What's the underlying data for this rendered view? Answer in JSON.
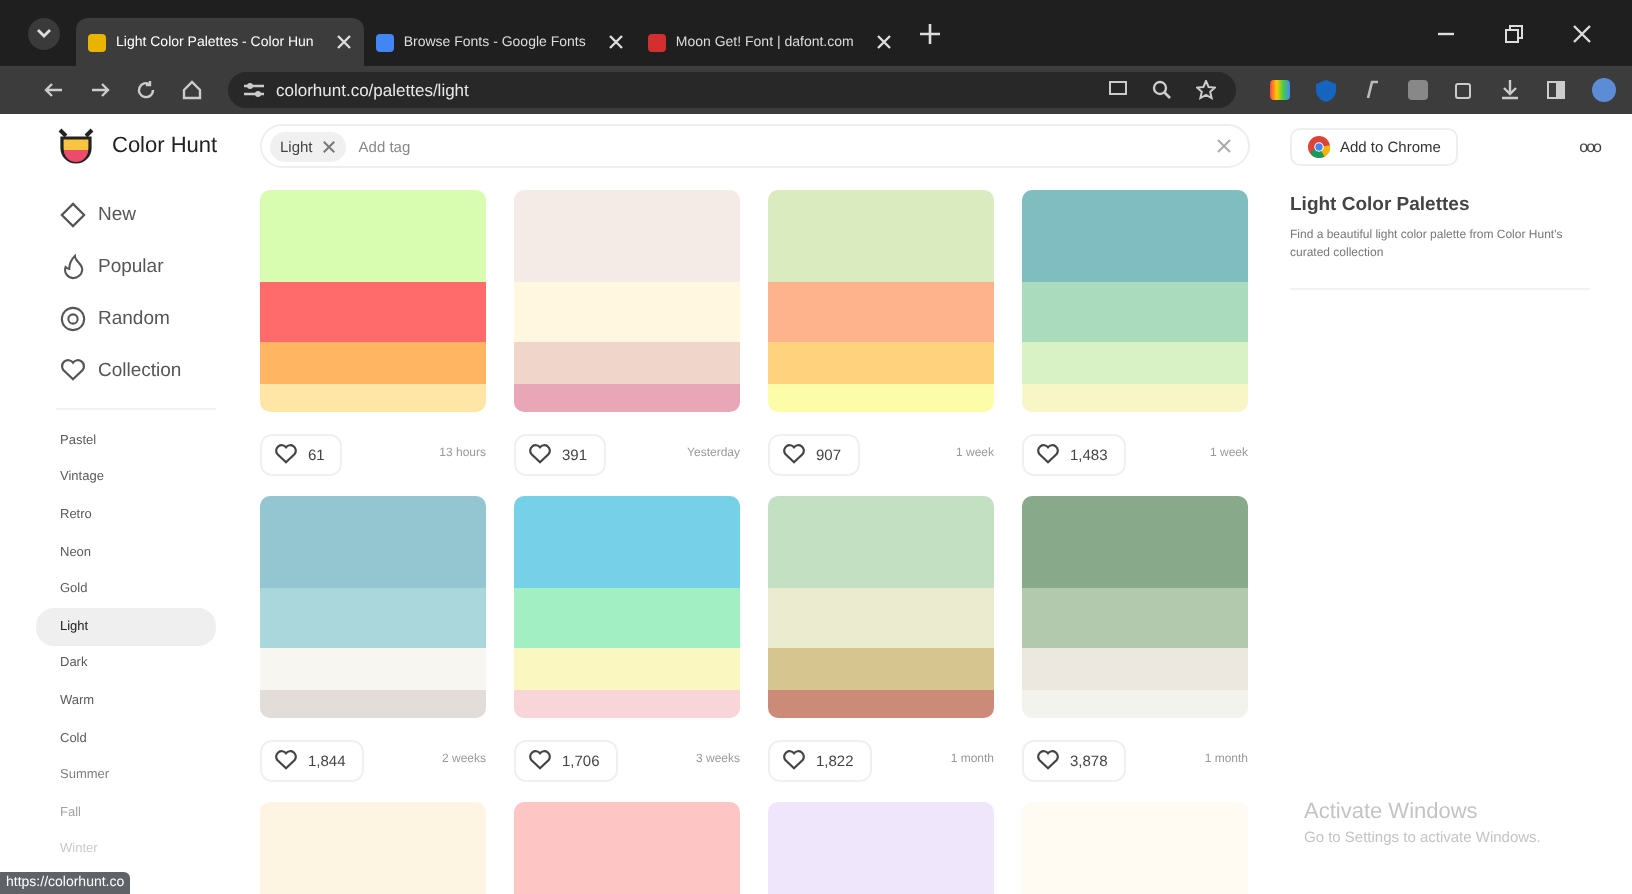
{
  "browser": {
    "tabs": [
      {
        "title": "Light Color Palettes - Color Hun",
        "selected": true
      },
      {
        "title": "Browse Fonts - Google Fonts",
        "selected": false
      },
      {
        "title": "Moon Get! Font | dafont.com",
        "selected": false
      }
    ],
    "url": "colorhunt.co/palettes/light"
  },
  "header": {
    "brand": "Color Hunt",
    "tag": "Light",
    "tag_placeholder": "Add tag",
    "chrome_button": "Add to Chrome",
    "menu": "ooo"
  },
  "sidebar": {
    "nav": [
      {
        "label": "New"
      },
      {
        "label": "Popular"
      },
      {
        "label": "Random"
      },
      {
        "label": "Collection"
      }
    ],
    "categories": [
      {
        "label": "Pastel",
        "selected": false
      },
      {
        "label": "Vintage",
        "selected": false
      },
      {
        "label": "Retro",
        "selected": false
      },
      {
        "label": "Neon",
        "selected": false
      },
      {
        "label": "Gold",
        "selected": false
      },
      {
        "label": "Light",
        "selected": true
      },
      {
        "label": "Dark",
        "selected": false
      },
      {
        "label": "Warm",
        "selected": false
      },
      {
        "label": "Cold",
        "selected": false
      },
      {
        "label": "Summer",
        "selected": false
      },
      {
        "label": "Fall",
        "selected": false
      },
      {
        "label": "Winter",
        "selected": false
      }
    ]
  },
  "palettes": [
    {
      "swatches": [
        {
          "color": "#d9fdb0"
        },
        {
          "color": "#ff6b6b"
        },
        {
          "color": "#ffb562"
        },
        {
          "color": "#ffe6a7"
        }
      ],
      "likes": "61",
      "age": "13 hours"
    },
    {
      "swatches": [
        {
          "color": "#f5ebe6"
        },
        {
          "color": "#fff7e0"
        },
        {
          "color": "#f0d5cb"
        },
        {
          "color": "#e8a6b6"
        }
      ],
      "likes": "391",
      "age": "Yesterday"
    },
    {
      "swatches": [
        {
          "color": "#d9ebbf"
        },
        {
          "color": "#ffb38c"
        },
        {
          "color": "#ffd27d"
        },
        {
          "color": "#fdfca9"
        }
      ],
      "likes": "907",
      "age": "1 week"
    },
    {
      "swatches": [
        {
          "color": "#7fbdc0"
        },
        {
          "color": "#abdbbd"
        },
        {
          "color": "#d8f2c5"
        },
        {
          "color": "#f8f6c6"
        }
      ],
      "likes": "1,483",
      "age": "1 week"
    },
    {
      "swatches": [
        {
          "color": "#93c6d0"
        },
        {
          "color": "#a9d7dc"
        },
        {
          "color": "#f7f6f0"
        },
        {
          "color": "#e2ddd8"
        }
      ],
      "likes": "1,844",
      "age": "2 weeks"
    },
    {
      "swatches": [
        {
          "color": "#76d1e8"
        },
        {
          "color": "#a2efc4"
        },
        {
          "color": "#fbf7c1"
        },
        {
          "color": "#f8d5d8"
        }
      ],
      "likes": "1,706",
      "age": "3 weeks"
    },
    {
      "swatches": [
        {
          "color": "#c3e0c3"
        },
        {
          "color": "#ebebcf"
        },
        {
          "color": "#d6c58f"
        },
        {
          "color": "#cc8b78"
        }
      ],
      "likes": "1,822",
      "age": "1 month"
    },
    {
      "swatches": [
        {
          "color": "#88a98a"
        },
        {
          "color": "#b2c9ad"
        },
        {
          "color": "#ede8df"
        },
        {
          "color": "#f3f3ee"
        }
      ],
      "likes": "3,878",
      "age": "1 month"
    },
    {
      "swatches": [
        {
          "color": "#fdf5e1"
        }
      ]
    },
    {
      "swatches": [
        {
          "color": "#fec5c5"
        }
      ]
    },
    {
      "swatches": [
        {
          "color": "#efe6fc"
        }
      ]
    },
    {
      "swatches": [
        {
          "color": "#fffbf2"
        }
      ]
    }
  ],
  "info": {
    "title": "Light Color Palettes",
    "text": "Find a beautiful light color palette from Color Hunt's curated collection"
  },
  "status_url": "https://colorhunt.co",
  "os_notice": {
    "title": "Activate Windows",
    "text": "Go to Settings to activate Windows."
  }
}
